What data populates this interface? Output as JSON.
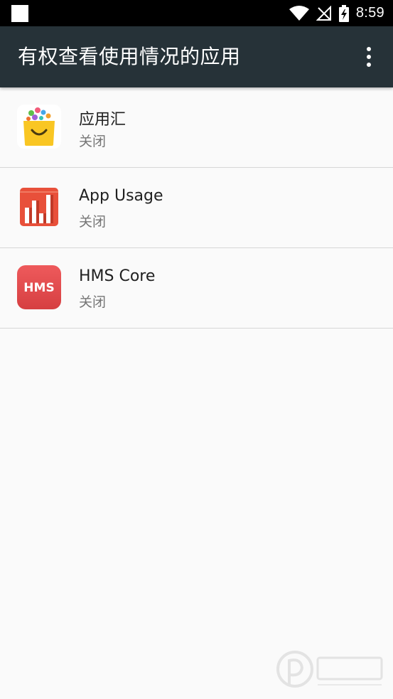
{
  "status_bar": {
    "time": "8:59",
    "icons": [
      "notification-square-icon",
      "wifi-icon",
      "no-signal-icon",
      "battery-charging-icon"
    ]
  },
  "app_bar": {
    "title": "有权查看使用情况的应用",
    "overflow_icon": "more-vert-icon"
  },
  "apps": [
    {
      "name": "应用汇",
      "status": "关闭",
      "icon": "yingyonghui-icon"
    },
    {
      "name": "App Usage",
      "status": "关闭",
      "icon": "app-usage-icon"
    },
    {
      "name": "HMS Core",
      "status": "关闭",
      "icon": "hms-core-icon",
      "icon_text": "HMS"
    }
  ],
  "watermark": {
    "icon": "watermark-logo-icon"
  },
  "colors": {
    "app_bar": "#263238",
    "status_bar": "#000000",
    "background": "#fafafa",
    "hms_red": "#e0484a",
    "usage_red": "#e8503a"
  }
}
